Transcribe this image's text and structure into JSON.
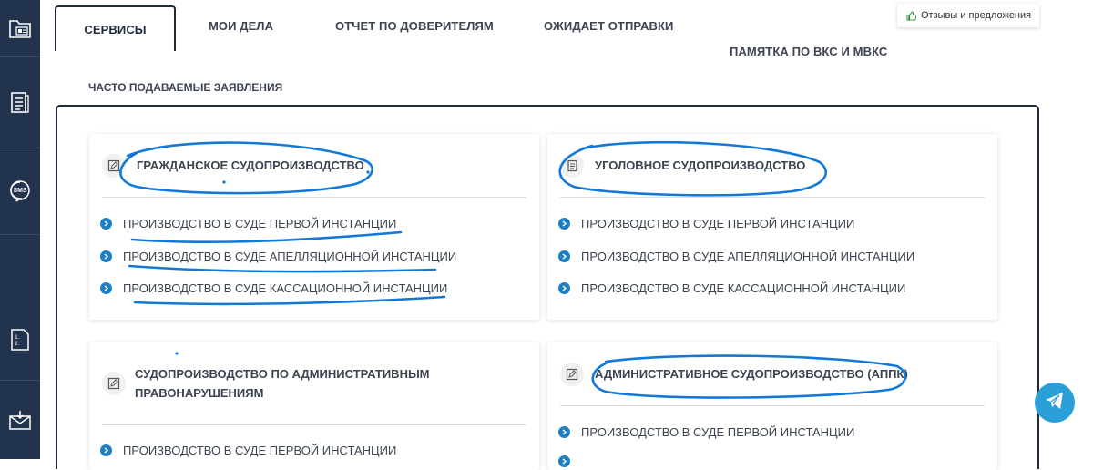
{
  "sidebar": {
    "items": [
      {
        "icon": "folder-id-icon"
      },
      {
        "icon": "document-list-icon"
      },
      {
        "icon": "sms-icon",
        "label": "SMS"
      },
      {
        "icon": "numbered-list-icon"
      },
      {
        "icon": "mail-icon"
      }
    ]
  },
  "tabs": {
    "services": "СЕРВИСЫ",
    "my_cases": "МОИ ДЕЛА",
    "trustees_report": "ОТЧЕТ ПО ДОВЕРИТЕЛЯМ",
    "awaiting_send": "ОЖИДАЕТ ОТПРАВКИ",
    "vks_memo": "ПАМЯТКА ПО ВКС И МВКС"
  },
  "feedback": {
    "label": "Отзывы и предложения"
  },
  "section_title": "ЧАСТО ПОДАВАЕМЫЕ ЗАЯВЛЕНИЯ",
  "cards": [
    {
      "title": "ГРАЖДАНСКОЕ СУДОПРОИЗВОДСТВО",
      "links": [
        "ПРОИЗВОДСТВО В СУДЕ ПЕРВОЙ ИНСТАНЦИИ",
        "ПРОИЗВОДСТВО В СУДЕ АПЕЛЛЯЦИОННОЙ ИНСТАНЦИИ",
        "ПРОИЗВОДСТВО В СУДЕ КАССАЦИОННОЙ ИНСТАНЦИИ"
      ]
    },
    {
      "title": "УГОЛОВНОЕ СУДОПРОИЗВОДСТВО",
      "links": [
        "ПРОИЗВОДСТВО В СУДЕ ПЕРВОЙ ИНСТАНЦИИ",
        "ПРОИЗВОДСТВО В СУДЕ АПЕЛЛЯЦИОННОЙ ИНСТАНЦИИ",
        "ПРОИЗВОДСТВО В СУДЕ КАССАЦИОННОЙ ИНСТАНЦИИ"
      ]
    },
    {
      "title": "СУДОПРОИЗВОДСТВО ПО АДМИНИСТРАТИВНЫМ ПРАВОНАРУШЕНИЯМ",
      "links": [
        "ПРОИЗВОДСТВО В СУДЕ ПЕРВОЙ ИНСТАНЦИИ"
      ]
    },
    {
      "title": "АДМИНИСТРАТИВНОЕ СУДОПРОИЗВОДСТВО (АППК)",
      "links": [
        "ПРОИЗВОДСТВО В СУДЕ ПЕРВОЙ ИНСТАНЦИИ"
      ]
    }
  ],
  "colors": {
    "sidebar": "#22334d",
    "accent": "#1e7fc4",
    "annotation": "#1479d6",
    "telegram": "#2a9fd8"
  }
}
